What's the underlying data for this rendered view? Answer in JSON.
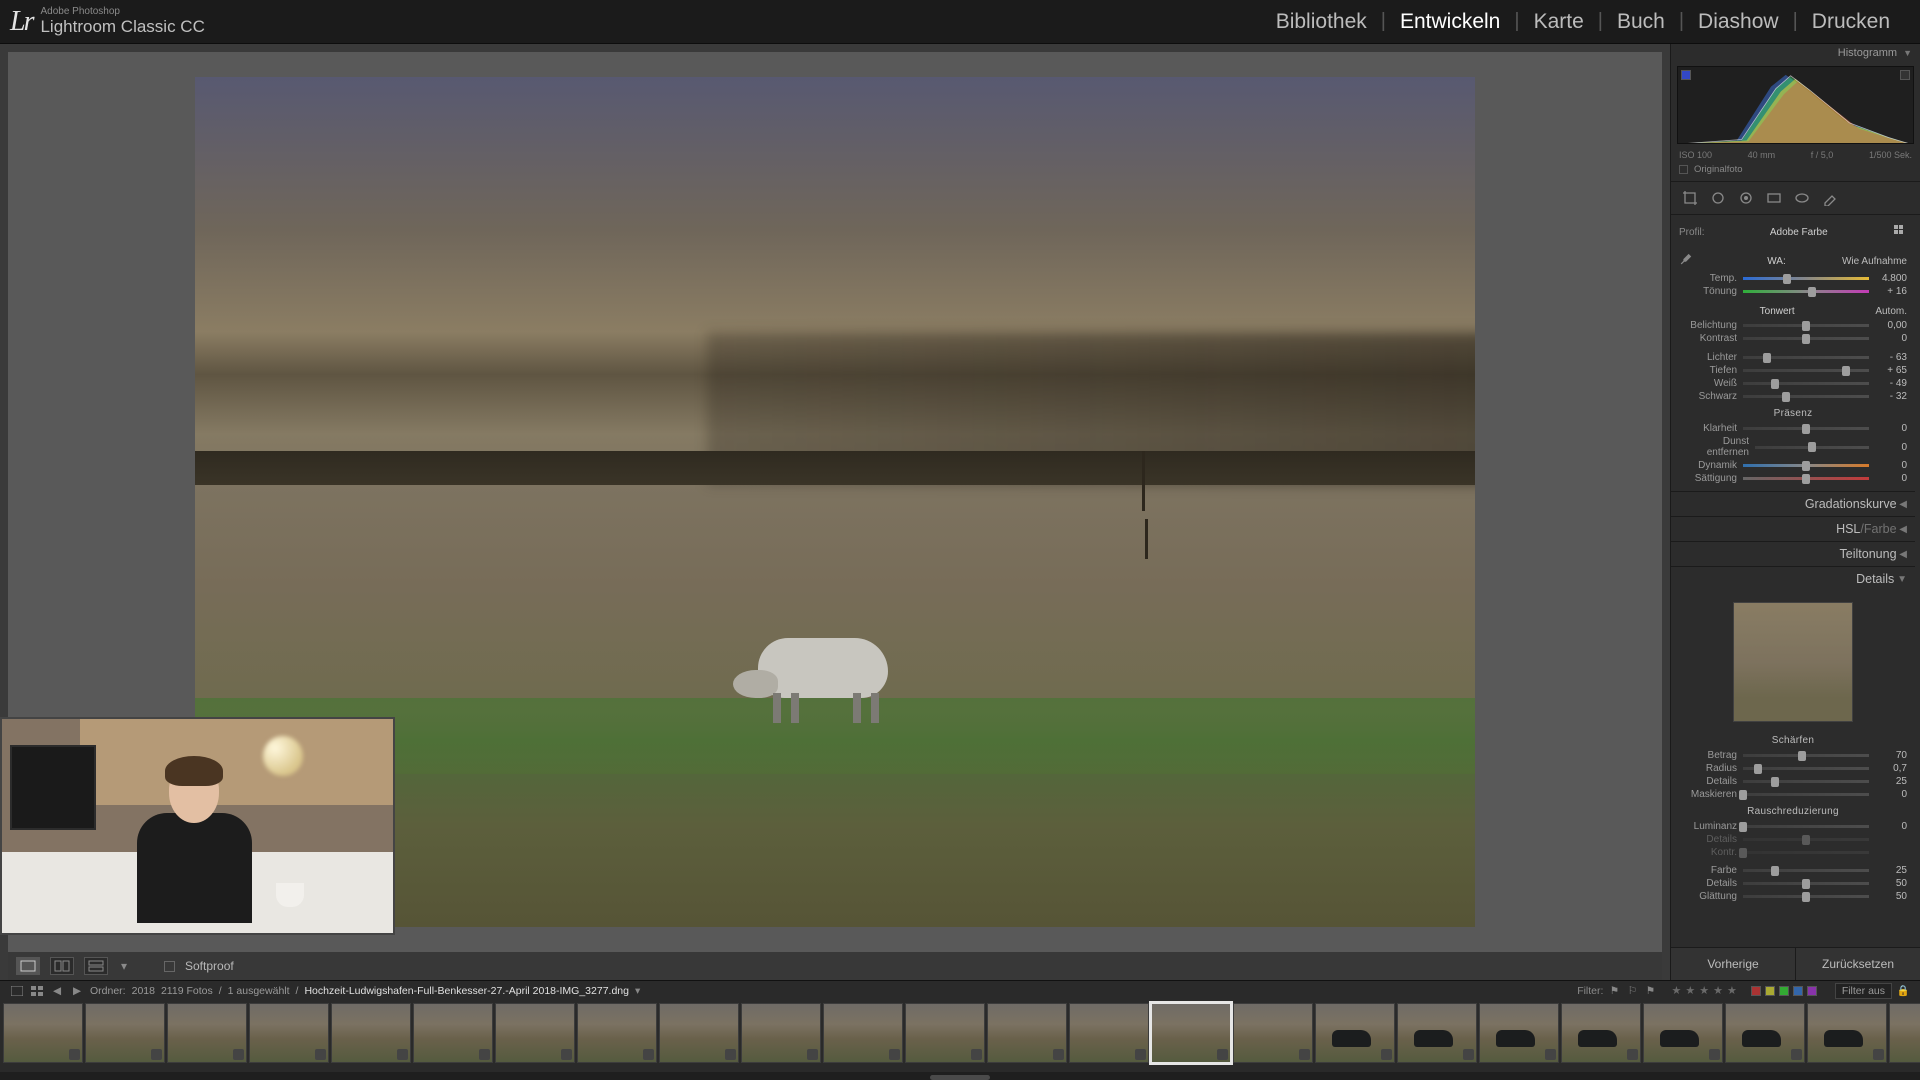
{
  "app": {
    "vendor": "Adobe Photoshop",
    "name": "Lightroom Classic CC"
  },
  "modules": [
    "Bibliothek",
    "Entwickeln",
    "Karte",
    "Buch",
    "Diashow",
    "Drucken"
  ],
  "active_module": "Entwickeln",
  "secondary_toolbar": {
    "softproof_label": "Softproof"
  },
  "histogram": {
    "title": "Histogramm",
    "meta": {
      "iso": "ISO 100",
      "focal": "40 mm",
      "aperture": "f / 5,0",
      "shutter": "1/500 Sek."
    },
    "original_label": "Originalfoto"
  },
  "basic": {
    "profile_label": "Profil:",
    "profile_value": "Adobe Farbe",
    "wb_label": "WA:",
    "wb_value": "Wie Aufnahme",
    "temp": {
      "label": "Temp.",
      "value": "4.800"
    },
    "tint": {
      "label": "Tönung",
      "value": "+ 16"
    },
    "tone_title": "Tonwert",
    "auto_label": "Autom.",
    "exposure": {
      "label": "Belichtung",
      "value": "0,00"
    },
    "contrast": {
      "label": "Kontrast",
      "value": "0"
    },
    "highlights": {
      "label": "Lichter",
      "value": "- 63"
    },
    "shadows": {
      "label": "Tiefen",
      "value": "+ 65"
    },
    "whites": {
      "label": "Weiß",
      "value": "- 49"
    },
    "blacks": {
      "label": "Schwarz",
      "value": "- 32"
    },
    "presence_title": "Präsenz",
    "clarity": {
      "label": "Klarheit",
      "value": "0"
    },
    "dehaze": {
      "label": "Dunst entfernen",
      "value": "0"
    },
    "vibrance": {
      "label": "Dynamik",
      "value": "0"
    },
    "saturation": {
      "label": "Sättigung",
      "value": "0"
    }
  },
  "panels": {
    "tone_curve": "Gradationskurve",
    "hsl": "HSL",
    "hsl_sub": "Farbe",
    "split_toning": "Teiltonung",
    "details": "Details"
  },
  "sharpen": {
    "title": "Schärfen",
    "amount": {
      "label": "Betrag",
      "value": "70"
    },
    "radius": {
      "label": "Radius",
      "value": "0,7"
    },
    "detail": {
      "label": "Details",
      "value": "25"
    },
    "masking": {
      "label": "Maskieren",
      "value": "0"
    }
  },
  "noise": {
    "title": "Rauschreduzierung",
    "luminance": {
      "label": "Luminanz",
      "value": "0"
    },
    "lumi_detail": {
      "label": "Details",
      "value": ""
    },
    "lumi_contrast": {
      "label": "Kontr.",
      "value": ""
    },
    "color": {
      "label": "Farbe",
      "value": "25"
    },
    "color_detail": {
      "label": "Details",
      "value": "50"
    },
    "smoothness": {
      "label": "Glättung",
      "value": "50"
    }
  },
  "bottom_buttons": {
    "prev": "Vorherige",
    "reset": "Zurücksetzen"
  },
  "filmstrip_info": {
    "folder_label": "Ordner:",
    "folder_value": "2018",
    "count": "2119 Fotos",
    "selected": "1 ausgewählt",
    "filename": "Hochzeit-Ludwigshafen-Full-Benkesser-27.-April 2018-IMG_3277.dng",
    "filter_label": "Filter:",
    "filter_off": "Filter aus"
  },
  "filmstrip_selected_index": 14
}
